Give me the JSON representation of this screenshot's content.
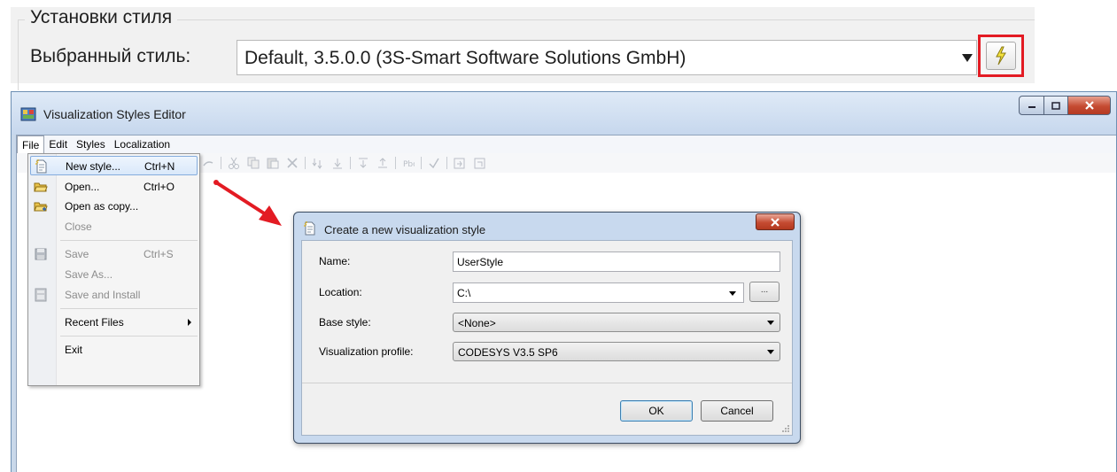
{
  "style_settings": {
    "group_title": "Установки стиля",
    "selected_style_label": "Выбранный стиль:",
    "selected_style_value": "Default, 3.5.0.0 (3S-Smart Software Solutions GmbH)"
  },
  "window": {
    "title": "Visualization Styles Editor",
    "menu": [
      "File",
      "Edit",
      "Styles",
      "Localization"
    ],
    "active_menu": "File"
  },
  "file_menu": {
    "items": [
      {
        "label": "New style...",
        "shortcut": "Ctrl+N",
        "selected": true,
        "disabled": false,
        "icon": "new-style-icon"
      },
      {
        "label": "Open...",
        "shortcut": "Ctrl+O",
        "selected": false,
        "disabled": false,
        "icon": "open-folder-icon"
      },
      {
        "label": "Open as copy...",
        "shortcut": "",
        "selected": false,
        "disabled": false,
        "icon": "open-copy-icon"
      },
      {
        "label": "Close",
        "shortcut": "",
        "selected": false,
        "disabled": true,
        "icon": ""
      },
      {
        "label": "Save",
        "shortcut": "Ctrl+S",
        "selected": false,
        "disabled": true,
        "icon": "save-icon"
      },
      {
        "label": "Save As...",
        "shortcut": "",
        "selected": false,
        "disabled": true,
        "icon": ""
      },
      {
        "label": "Save and Install",
        "shortcut": "",
        "selected": false,
        "disabled": true,
        "icon": "save-install-icon"
      },
      {
        "label": "Recent Files",
        "shortcut": "",
        "selected": false,
        "disabled": false,
        "icon": "",
        "submenu": true
      },
      {
        "label": "Exit",
        "shortcut": "",
        "selected": false,
        "disabled": false,
        "icon": ""
      }
    ]
  },
  "dialog": {
    "title": "Create a new visualization style",
    "name_label": "Name:",
    "name_value": "UserStyle",
    "location_label": "Location:",
    "location_value": "C:\\",
    "browse_label": "...",
    "base_style_label": "Base style:",
    "base_style_value": "<None>",
    "profile_label": "Visualization profile:",
    "profile_value": "CODESYS V3.5 SP6",
    "ok_label": "OK",
    "cancel_label": "Cancel"
  },
  "colors": {
    "highlight_red": "#e31b23",
    "close_red": "#c54b32",
    "menu_selection": "#d9e8fa"
  }
}
